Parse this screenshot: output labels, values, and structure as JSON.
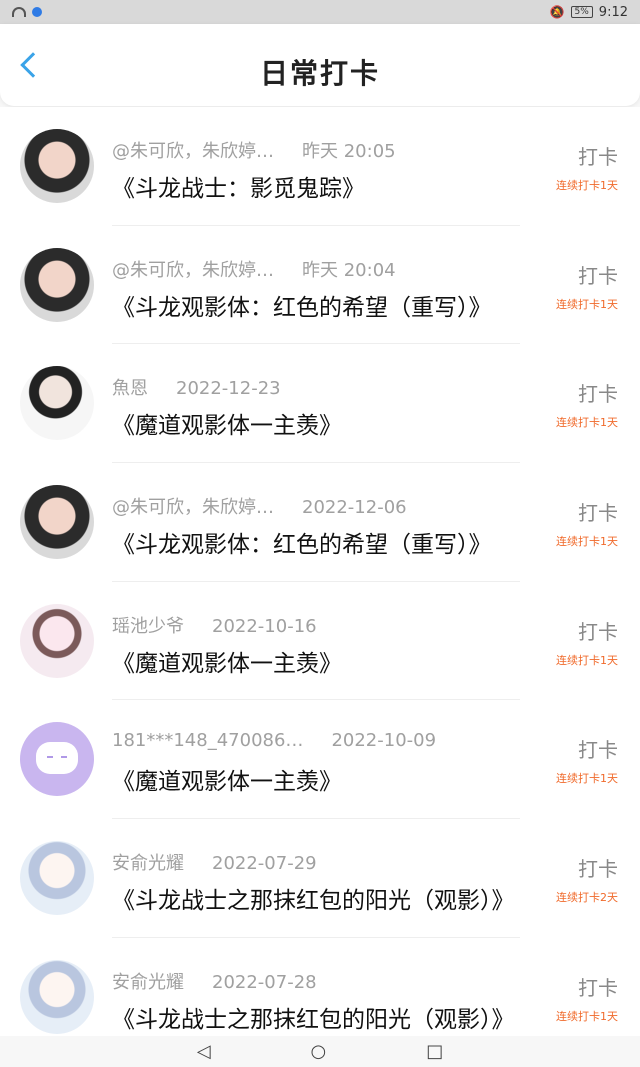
{
  "status": {
    "time": "9:12",
    "battery": "5%"
  },
  "header": {
    "title": "日常打卡"
  },
  "items": [
    {
      "user": "@朱可欣，朱欣婷…",
      "time": "昨天 20:05",
      "book": "《斗龙战士：影觅鬼踪》",
      "action": "打卡",
      "streak": "连续打卡1天",
      "avatar": "person"
    },
    {
      "user": "@朱可欣，朱欣婷…",
      "time": "昨天 20:04",
      "book": "《斗龙观影体：红色的希望（重写）》",
      "action": "打卡",
      "streak": "连续打卡1天",
      "avatar": "person"
    },
    {
      "user": "魚恩",
      "time": "2022-12-23",
      "book": "《魔道观影体一主羡》",
      "action": "打卡",
      "streak": "连续打卡1天",
      "avatar": "photo"
    },
    {
      "user": "@朱可欣，朱欣婷…",
      "time": "2022-12-06",
      "book": "《斗龙观影体：红色的希望（重写）》",
      "action": "打卡",
      "streak": "连续打卡1天",
      "avatar": "person"
    },
    {
      "user": "瑶池少爷",
      "time": "2022-10-16",
      "book": "《魔道观影体一主羡》",
      "action": "打卡",
      "streak": "连续打卡1天",
      "avatar": "anime"
    },
    {
      "user": "181***148_470086…",
      "time": "2022-10-09",
      "book": "《魔道观影体一主羡》",
      "action": "打卡",
      "streak": "连续打卡1天",
      "avatar": "purple"
    },
    {
      "user": "安俞光耀",
      "time": "2022-07-29",
      "book": "《斗龙战士之那抹红包的阳光（观影）》",
      "action": "打卡",
      "streak": "连续打卡2天",
      "avatar": "blue"
    },
    {
      "user": "安俞光耀",
      "time": "2022-07-28",
      "book": "《斗龙战士之那抹红包的阳光（观影）》",
      "action": "打卡",
      "streak": "连续打卡1天",
      "avatar": "blue"
    }
  ],
  "navigation": {
    "back": "◁",
    "home": "○",
    "recent": "□"
  }
}
